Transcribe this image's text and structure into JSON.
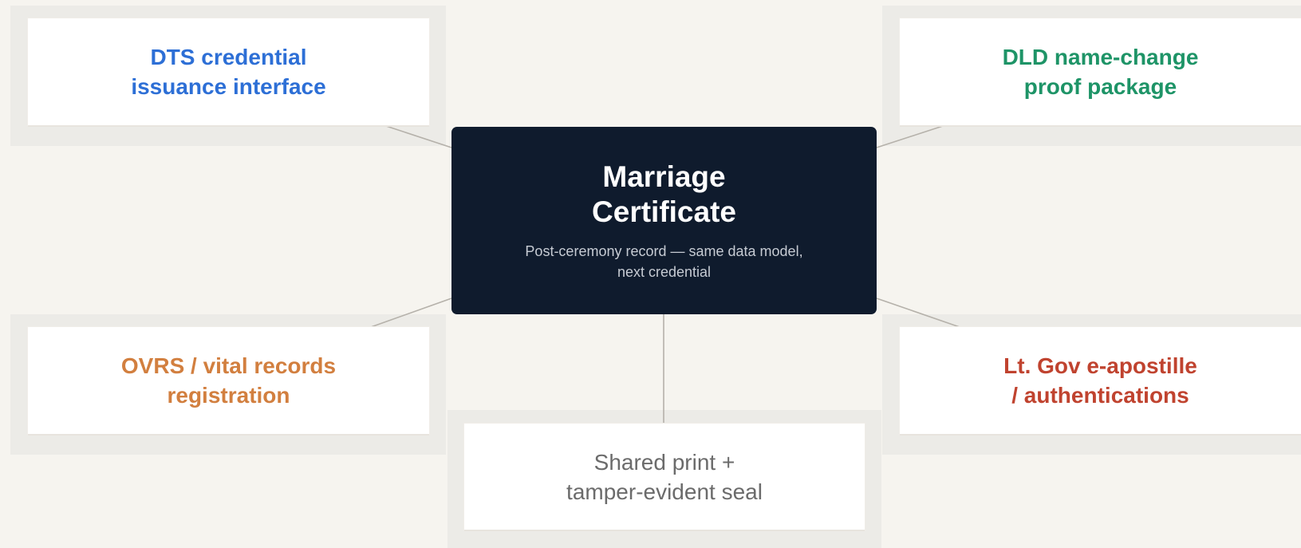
{
  "hub": {
    "title": "Marriage\nCertificate",
    "subtitle": "Post-ceremony record — same data model,\nnext credential"
  },
  "nodes": {
    "dts": {
      "label": "DTS credential\nissuance interface",
      "color": "#2d6fd6"
    },
    "dld": {
      "label": "DLD name-change\nproof package",
      "color": "#1e9467"
    },
    "ovrs": {
      "label": "OVRS / vital records\nregistration",
      "color": "#d27f3f"
    },
    "apostille": {
      "label": "Lt. Gov e-apostille\n/ authentications",
      "color": "#c0432f"
    },
    "seal": {
      "label": "Shared print +\ntamper-evident seal",
      "color": "#6b6b6b"
    }
  }
}
